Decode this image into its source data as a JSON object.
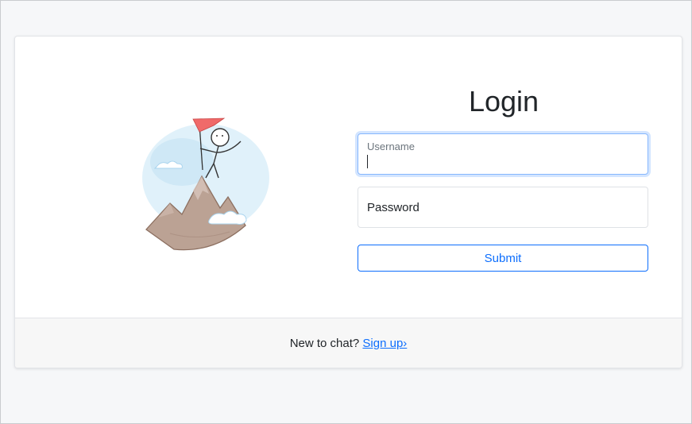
{
  "login": {
    "title": "Login",
    "username": {
      "label": "Username",
      "value": ""
    },
    "password": {
      "label": "Password",
      "value": ""
    },
    "submit_label": "Submit"
  },
  "footer": {
    "prompt": "New to chat?",
    "signup_link": "Sign up›"
  },
  "illustration": {
    "icon": "stick-figure-on-mountain-with-flag"
  },
  "colors": {
    "accent": "#0d6efd",
    "focus_border": "#86b7fe",
    "flag": "#f06a6a",
    "mountain": "#b49a8c",
    "sky": "#cfe8f5"
  }
}
